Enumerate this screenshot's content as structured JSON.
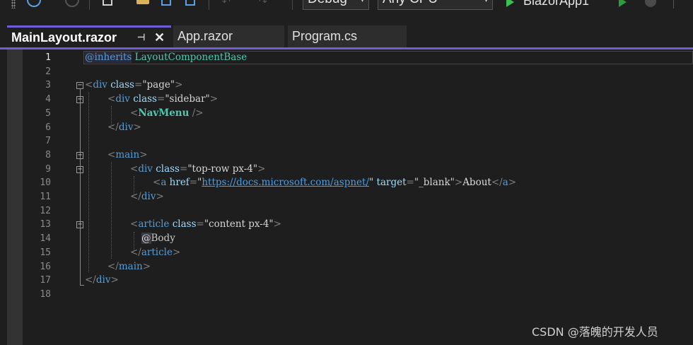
{
  "toolbar": {
    "configuration": "Debug",
    "platform": "Any CPU",
    "run_target": "BlazorApp1"
  },
  "tabs": [
    {
      "label": "MainLayout.razor",
      "active": true
    },
    {
      "label": "App.razor",
      "active": false
    },
    {
      "label": "Program.cs",
      "active": false
    }
  ],
  "icons": {
    "pin": "pin-icon",
    "close": "close-icon",
    "fold": "collapse-icon"
  },
  "colors": {
    "accent": "#6f5fd6",
    "tag": "#569cd6",
    "attribute": "#9cdcfe",
    "component": "#4ec9b0",
    "link": "#4a9ee8"
  },
  "editor": {
    "current_line": 1,
    "line_numbers": [
      "1",
      "2",
      "3",
      "4",
      "5",
      "6",
      "7",
      "8",
      "9",
      "10",
      "11",
      "12",
      "13",
      "14",
      "15",
      "16",
      "17",
      "18"
    ],
    "code": {
      "l1_dir": "@inherits",
      "l1_type": "LayoutComponentBase",
      "div": "div",
      "class_attr": "class",
      "href_attr": "href",
      "target_attr": "target",
      "page_val": "\"page\"",
      "sidebar_val": "\"sidebar\"",
      "navmenu": "NavMenu",
      "main": "main",
      "toprow_val": "\"top-row px-4\"",
      "a": "a",
      "url": "https://docs.microsoft.com/aspnet/",
      "blank_val": "\"_blank\"",
      "about": "About",
      "article": "article",
      "content_val": "\"content px-4\"",
      "body_at": "@",
      "body": "Body"
    }
  },
  "watermark": "CSDN @落魄的开发人员"
}
